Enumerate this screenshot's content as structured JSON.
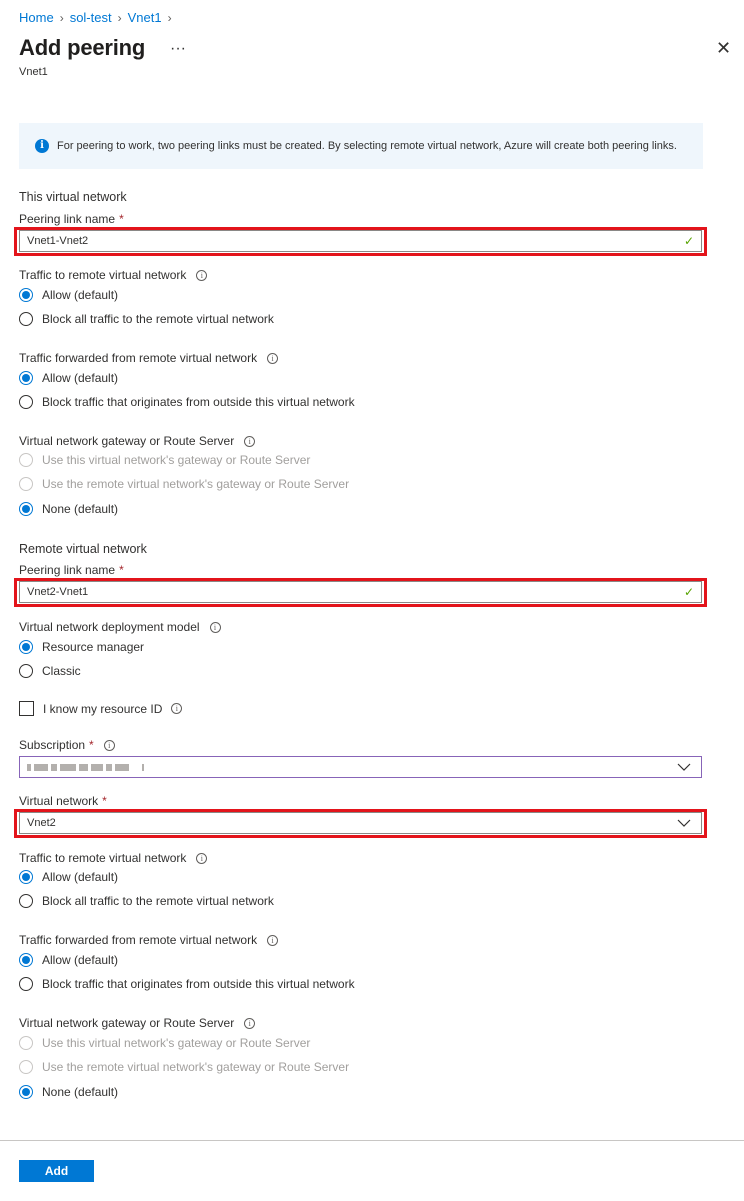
{
  "breadcrumb": [
    "Home",
    "sol-test",
    "Vnet1"
  ],
  "header": {
    "title": "Add peering",
    "subtitle": "Vnet1",
    "more": "···",
    "close": "✕"
  },
  "info_banner": {
    "icon": "i",
    "text": "For peering to work, two peering links must be created. By selecting remote virtual network, Azure will create both peering links."
  },
  "this_vnet": {
    "section": "This virtual network",
    "peering_label": "Peering link name",
    "peering_value": "Vnet1-Vnet2",
    "traffic_to_remote": {
      "label": "Traffic to remote virtual network",
      "options": [
        "Allow (default)",
        "Block all traffic to the remote virtual network"
      ],
      "selected": 0
    },
    "traffic_forwarded": {
      "label": "Traffic forwarded from remote virtual network",
      "options": [
        "Allow (default)",
        "Block traffic that originates from outside this virtual network"
      ],
      "selected": 0
    },
    "gateway": {
      "label": "Virtual network gateway or Route Server",
      "options": [
        "Use this virtual network's gateway or Route Server",
        "Use the remote virtual network's gateway or Route Server",
        "None (default)"
      ],
      "selected": 2
    }
  },
  "remote_vnet": {
    "section": "Remote virtual network",
    "peering_label": "Peering link name",
    "peering_value": "Vnet2-Vnet1",
    "deployment_model": {
      "label": "Virtual network deployment model",
      "options": [
        "Resource manager",
        "Classic"
      ],
      "selected": 0
    },
    "resource_id_checkbox": "I know my resource ID",
    "subscription_label": "Subscription",
    "subscription_value": "",
    "vnet_label": "Virtual network",
    "vnet_value": "Vnet2",
    "traffic_to_remote": {
      "label": "Traffic to remote virtual network",
      "options": [
        "Allow (default)",
        "Block all traffic to the remote virtual network"
      ],
      "selected": 0
    },
    "traffic_forwarded": {
      "label": "Traffic forwarded from remote virtual network",
      "options": [
        "Allow (default)",
        "Block traffic that originates from outside this virtual network"
      ],
      "selected": 0
    },
    "gateway": {
      "label": "Virtual network gateway or Route Server",
      "options": [
        "Use this virtual network's gateway or Route Server",
        "Use the remote virtual network's gateway or Route Server",
        "None (default)"
      ],
      "selected": 2
    }
  },
  "required_marker": "*",
  "info_glyph": "i",
  "check_glyph": "✓",
  "footer": {
    "add_label": "Add"
  },
  "colors": {
    "accent": "#0078d4",
    "highlight": "#e3141b",
    "info_bg": "#eff6fc",
    "valid": "#57a300"
  }
}
